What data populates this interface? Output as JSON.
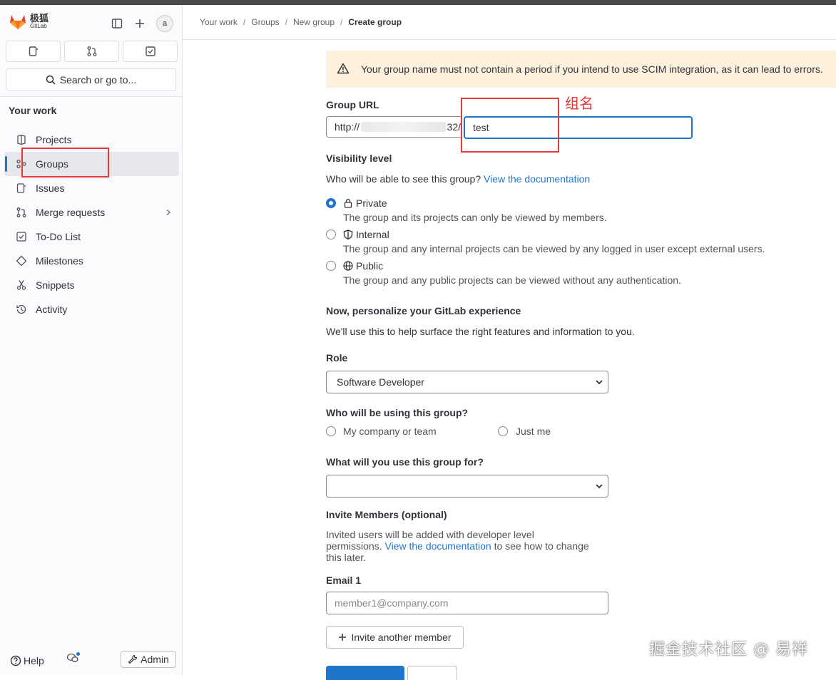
{
  "brand": {
    "name_cn": "极狐",
    "name_en": "GitLab"
  },
  "sidebar": {
    "avatar_text": "a",
    "search_placeholder": "Search or go to...",
    "section_title": "Your work",
    "items": [
      {
        "label": "Projects",
        "icon": "project-icon"
      },
      {
        "label": "Groups",
        "icon": "group-icon",
        "active": true
      },
      {
        "label": "Issues",
        "icon": "issues-icon"
      },
      {
        "label": "Merge requests",
        "icon": "merge-request-icon",
        "chevron": true
      },
      {
        "label": "To-Do List",
        "icon": "todo-icon"
      },
      {
        "label": "Milestones",
        "icon": "milestone-icon"
      },
      {
        "label": "Snippets",
        "icon": "snippet-icon"
      },
      {
        "label": "Activity",
        "icon": "history-icon"
      }
    ],
    "help_label": "Help",
    "admin_label": "Admin"
  },
  "breadcrumb": [
    "Your work",
    "Groups",
    "New group",
    "Create group"
  ],
  "alert": {
    "text": "Your group name must not contain a period if you intend to use SCIM integration, as it can lead to errors."
  },
  "form": {
    "group_url_label": "Group URL",
    "url_prefix_start": "http://",
    "url_prefix_end": "32/",
    "group_path_value": "test",
    "visibility_label": "Visibility level",
    "visibility_help": "Who will be able to see this group?",
    "visibility_help_link": "View the documentation",
    "visibility_options": [
      {
        "label": "Private",
        "desc": "The group and its projects can only be viewed by members.",
        "checked": true
      },
      {
        "label": "Internal",
        "desc": "The group and any internal projects can be viewed by any logged in user except external users.",
        "checked": false
      },
      {
        "label": "Public",
        "desc": "The group and any public projects can be viewed without any authentication.",
        "checked": false
      }
    ],
    "personalize_title": "Now, personalize your GitLab experience",
    "personalize_desc": "We'll use this to help surface the right features and information to you.",
    "role_label": "Role",
    "role_value": "Software Developer",
    "who_label": "Who will be using this group?",
    "who_options": [
      "My company or team",
      "Just me"
    ],
    "use_label": "What will you use this group for?",
    "use_value": "",
    "invite_title": "Invite Members (optional)",
    "invite_desc_1": "Invited users will be added with developer level",
    "invite_desc_2a": "permissions.",
    "invite_desc_link": "View the documentation",
    "invite_desc_2b": "to see how to change",
    "invite_desc_3": "this later.",
    "email_label": "Email 1",
    "email_placeholder": "member1@company.com",
    "invite_another_label": "Invite another member"
  },
  "annotation": {
    "text": "组名",
    "color": "#e53935"
  },
  "watermark": "掘金技术社区 @ 易祥",
  "colors": {
    "accent": "#1f75cb",
    "alert_bg": "#fdf1dd",
    "annotation_red": "#e53935"
  }
}
